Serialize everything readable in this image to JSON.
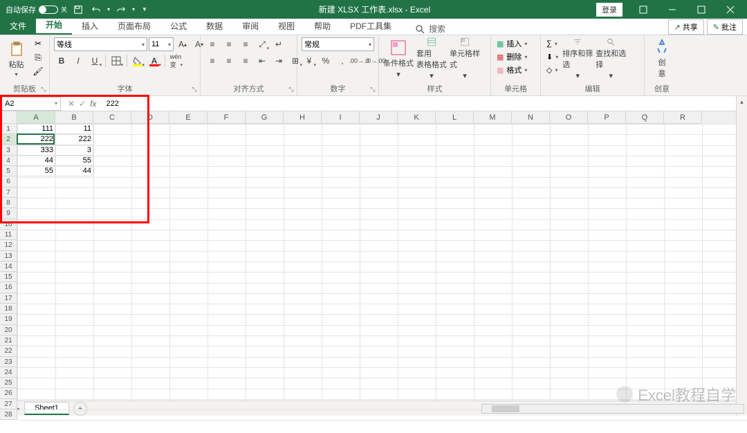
{
  "titlebar": {
    "autosave_label": "自动保存",
    "autosave_state": "关",
    "document_title": "新建 XLSX 工作表.xlsx  -  Excel",
    "login": "登录"
  },
  "tabs": {
    "file": "文件",
    "items": [
      "开始",
      "插入",
      "页面布局",
      "公式",
      "数据",
      "审阅",
      "视图",
      "帮助",
      "PDF工具集"
    ],
    "active_index": 0,
    "search_label": "搜索",
    "share": "共享",
    "comments": "批注"
  },
  "ribbon": {
    "clipboard": {
      "paste": "粘贴",
      "label": "剪贴板"
    },
    "font": {
      "name": "等线",
      "size": "11",
      "label": "字体",
      "bold": "B",
      "italic": "I",
      "underline": "U"
    },
    "alignment": {
      "label": "对齐方式"
    },
    "number": {
      "format": "常规",
      "label": "数字"
    },
    "styles": {
      "cond": "条件格式",
      "table": "套用\n表格格式",
      "cell": "单元格样式",
      "label": "样式"
    },
    "cells": {
      "insert": "插入",
      "delete": "删除",
      "format": "格式",
      "label": "单元格"
    },
    "editing": {
      "sort": "排序和筛选",
      "find": "查找和选择",
      "label": "编辑"
    },
    "ideas": {
      "btn": "创\n意",
      "label": "创意"
    }
  },
  "formula_bar": {
    "name_box": "A2",
    "formula": "222"
  },
  "grid": {
    "columns": [
      "A",
      "B",
      "C",
      "D",
      "E",
      "F",
      "G",
      "H",
      "I",
      "J",
      "K",
      "L",
      "M",
      "N",
      "O",
      "P",
      "Q",
      "R"
    ],
    "row_count": 28,
    "data": {
      "A1": "111",
      "B1": "11",
      "A2": "222",
      "B2": "222",
      "A3": "333",
      "B3": "3",
      "A4": "44",
      "B4": "55",
      "A5": "55",
      "B5": "44"
    },
    "active_cell": "A2"
  },
  "sheet_tabs": {
    "active": "Sheet1"
  },
  "watermark": "Excel教程自学",
  "colors": {
    "brand": "#217346",
    "highlight": "#ff0000"
  }
}
